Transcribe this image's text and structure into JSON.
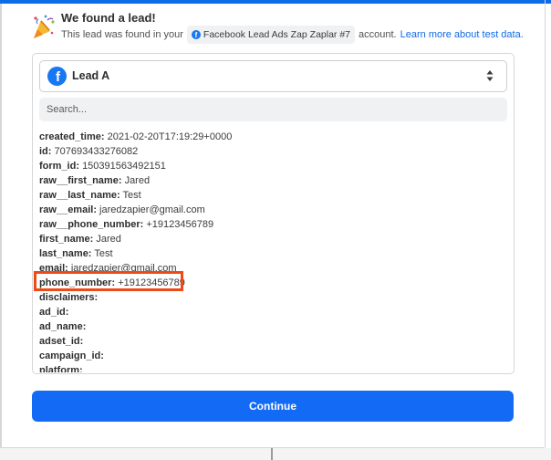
{
  "header": {
    "title": "We found a lead!",
    "desc_prefix": "This lead was found in your",
    "account_chip": "Facebook Lead Ads Zap Zaplar #7",
    "desc_suffix": "account.",
    "learn_link": "Learn more about test data."
  },
  "lead_select": {
    "value": "Lead A"
  },
  "search": {
    "placeholder": "Search..."
  },
  "fields": [
    {
      "key": "created_time:",
      "value": "2021-02-20T17:19:29+0000"
    },
    {
      "key": "id:",
      "value": "707693433276082"
    },
    {
      "key": "form_id:",
      "value": "150391563492151"
    },
    {
      "key": "raw__first_name:",
      "value": "Jared"
    },
    {
      "key": "raw__last_name:",
      "value": "Test"
    },
    {
      "key": "raw__email:",
      "value": "jaredzapier@gmail.com"
    },
    {
      "key": "raw__phone_number:",
      "value": "+19123456789"
    },
    {
      "key": "first_name:",
      "value": "Jared"
    },
    {
      "key": "last_name:",
      "value": "Test"
    },
    {
      "key": "email:",
      "value": "jaredzapier@gmail.com"
    },
    {
      "key": "phone_number:",
      "value": "+19123456789"
    },
    {
      "key": "disclaimers:",
      "value": ""
    },
    {
      "key": "ad_id:",
      "value": ""
    },
    {
      "key": "ad_name:",
      "value": ""
    },
    {
      "key": "adset_id:",
      "value": ""
    },
    {
      "key": "campaign_id:",
      "value": ""
    },
    {
      "key": "platform:",
      "value": ""
    }
  ],
  "continue_label": "Continue",
  "colors": {
    "accent": "#136bf5",
    "highlight": "#ef4a15",
    "facebook": "#1877f2"
  },
  "icons": {
    "header": "party-popper-icon",
    "lead": "facebook-icon",
    "select": "chevron-up-down-icon"
  }
}
